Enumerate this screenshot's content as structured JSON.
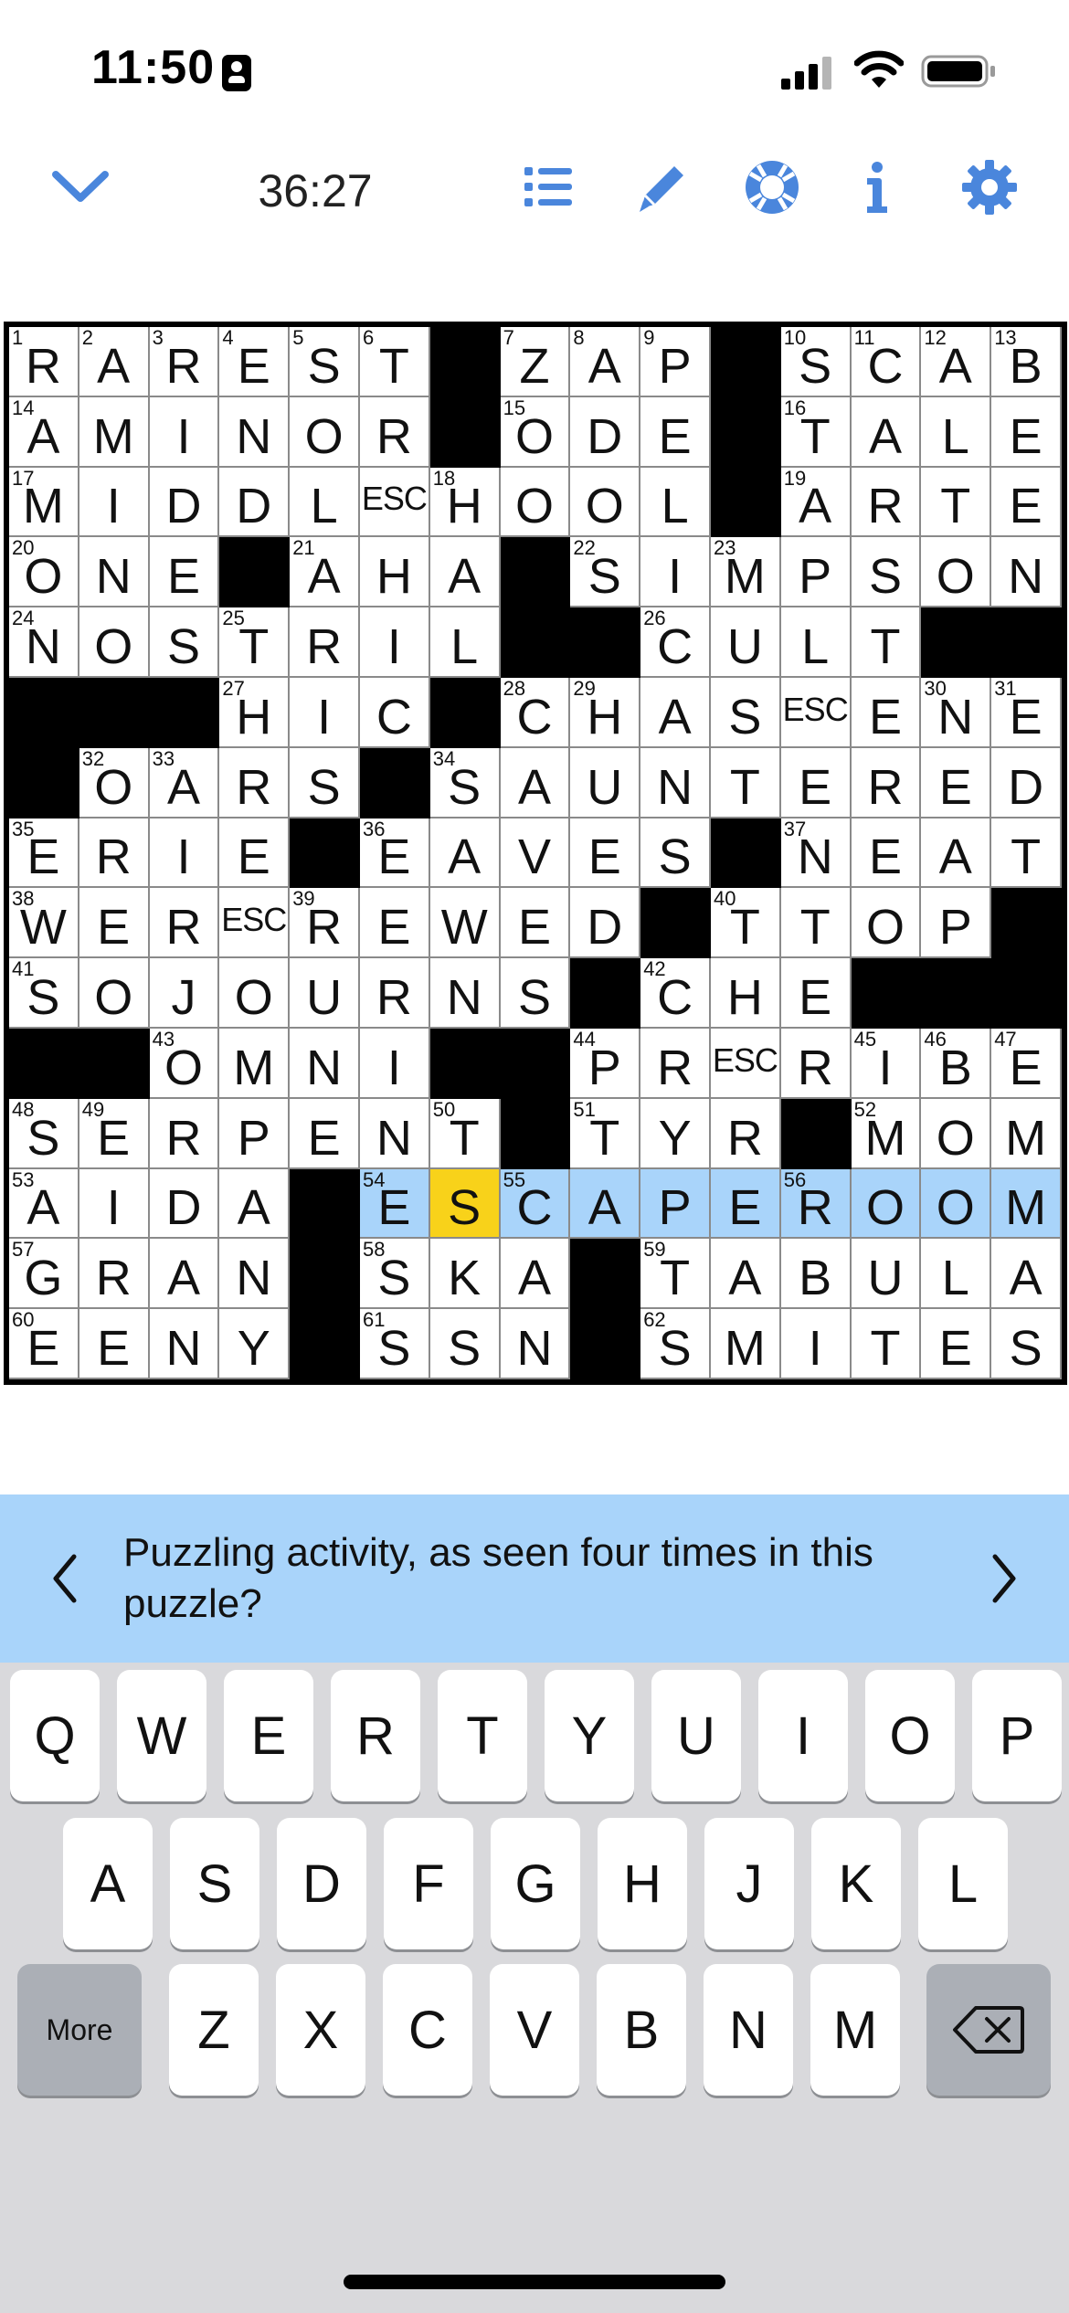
{
  "status_bar": {
    "time": "11:50",
    "icons": [
      "id-badge-icon",
      "signal-icon",
      "wifi-icon",
      "battery-icon"
    ]
  },
  "toolbar": {
    "timer": "36:27",
    "icons": [
      "chevron-down-icon",
      "list-icon",
      "pencil-icon",
      "lifebuoy-icon",
      "info-icon",
      "gear-icon"
    ],
    "accent_color": "#4a86dc"
  },
  "puzzle": {
    "grid": [
      [
        "R",
        "A",
        "R",
        "E",
        "S",
        "T",
        "#",
        "Z",
        "A",
        "P",
        "#",
        "S",
        "C",
        "A",
        "B"
      ],
      [
        "A",
        "M",
        "I",
        "N",
        "O",
        "R",
        "#",
        "O",
        "D",
        "E",
        "#",
        "T",
        "A",
        "L",
        "E"
      ],
      [
        "M",
        "I",
        "D",
        "D",
        "L",
        "ESC",
        "H",
        "O",
        "O",
        "L",
        "#",
        "A",
        "R",
        "T",
        "E"
      ],
      [
        "O",
        "N",
        "E",
        "#",
        "A",
        "H",
        "A",
        "#",
        "S",
        "I",
        "M",
        "P",
        "S",
        "O",
        "N"
      ],
      [
        "N",
        "O",
        "S",
        "T",
        "R",
        "I",
        "L",
        "#",
        "#",
        "C",
        "U",
        "L",
        "T",
        "#",
        "#"
      ],
      [
        "#",
        "#",
        "#",
        "H",
        "I",
        "C",
        "#",
        "C",
        "H",
        "A",
        "S",
        "ESC",
        "E",
        "N",
        "E"
      ],
      [
        "#",
        "O",
        "A",
        "R",
        "S",
        "#",
        "S",
        "A",
        "U",
        "N",
        "T",
        "E",
        "R",
        "E",
        "D"
      ],
      [
        "E",
        "R",
        "I",
        "E",
        "#",
        "E",
        "A",
        "V",
        "E",
        "S",
        "#",
        "N",
        "E",
        "A",
        "T"
      ],
      [
        "W",
        "E",
        "R",
        "ESC",
        "R",
        "E",
        "W",
        "E",
        "D",
        "#",
        "T",
        "T",
        "O",
        "P",
        "#"
      ],
      [
        "S",
        "O",
        "J",
        "O",
        "U",
        "R",
        "N",
        "S",
        "#",
        "C",
        "H",
        "E",
        "#",
        "#",
        "#"
      ],
      [
        "#",
        "#",
        "O",
        "M",
        "N",
        "I",
        "#",
        "#",
        "P",
        "R",
        "ESC",
        "R",
        "I",
        "B",
        "E"
      ],
      [
        "S",
        "E",
        "R",
        "P",
        "E",
        "N",
        "T",
        "#",
        "T",
        "Y",
        "R",
        "#",
        "M",
        "O",
        "M"
      ],
      [
        "A",
        "I",
        "D",
        "A",
        "#",
        "E",
        "S",
        "C",
        "A",
        "P",
        "E",
        "R",
        "O",
        "O",
        "M"
      ],
      [
        "G",
        "R",
        "A",
        "N",
        "#",
        "S",
        "K",
        "A",
        "#",
        "T",
        "A",
        "B",
        "U",
        "L",
        "A"
      ],
      [
        "E",
        "E",
        "N",
        "Y",
        "#",
        "S",
        "S",
        "N",
        "#",
        "S",
        "M",
        "I",
        "T",
        "E",
        "S"
      ]
    ],
    "numbers": [
      [
        1,
        2,
        3,
        4,
        5,
        6,
        0,
        7,
        8,
        9,
        0,
        10,
        11,
        12,
        13
      ],
      [
        14,
        0,
        0,
        0,
        0,
        0,
        0,
        15,
        0,
        0,
        0,
        16,
        0,
        0,
        0
      ],
      [
        17,
        0,
        0,
        0,
        0,
        0,
        18,
        0,
        0,
        0,
        0,
        19,
        0,
        0,
        0
      ],
      [
        20,
        0,
        0,
        0,
        21,
        0,
        0,
        0,
        22,
        0,
        23,
        0,
        0,
        0,
        0
      ],
      [
        24,
        0,
        0,
        25,
        0,
        0,
        0,
        0,
        0,
        26,
        0,
        0,
        0,
        0,
        0
      ],
      [
        0,
        0,
        0,
        27,
        0,
        0,
        0,
        28,
        29,
        0,
        0,
        0,
        0,
        30,
        31
      ],
      [
        0,
        32,
        33,
        0,
        0,
        0,
        34,
        0,
        0,
        0,
        0,
        0,
        0,
        0,
        0
      ],
      [
        35,
        0,
        0,
        0,
        0,
        36,
        0,
        0,
        0,
        0,
        0,
        37,
        0,
        0,
        0
      ],
      [
        38,
        0,
        0,
        0,
        39,
        0,
        0,
        0,
        0,
        0,
        40,
        0,
        0,
        0,
        0
      ],
      [
        41,
        0,
        0,
        0,
        0,
        0,
        0,
        0,
        0,
        42,
        0,
        0,
        0,
        0,
        0
      ],
      [
        0,
        0,
        43,
        0,
        0,
        0,
        0,
        0,
        44,
        0,
        0,
        0,
        45,
        46,
        47
      ],
      [
        48,
        49,
        0,
        0,
        0,
        0,
        50,
        0,
        51,
        0,
        0,
        0,
        52,
        0,
        0
      ],
      [
        53,
        0,
        0,
        0,
        0,
        54,
        0,
        55,
        0,
        0,
        0,
        56,
        0,
        0,
        0
      ],
      [
        57,
        0,
        0,
        0,
        0,
        58,
        0,
        0,
        0,
        59,
        0,
        0,
        0,
        0,
        0
      ],
      [
        60,
        0,
        0,
        0,
        0,
        61,
        0,
        0,
        0,
        62,
        0,
        0,
        0,
        0,
        0
      ]
    ],
    "highlighted_row": 12,
    "highlighted_cols": [
      5,
      6,
      7,
      8,
      9,
      10,
      11,
      12,
      13,
      14
    ],
    "cursor": {
      "row": 12,
      "col": 6
    },
    "colors": {
      "highlight": "#a9d4fa",
      "cursor": "#f8d21a"
    }
  },
  "clue": {
    "text": "Puzzling activity, as seen four times in this puzzle?",
    "prev_icon": "chevron-left-icon",
    "next_icon": "chevron-right-icon"
  },
  "keyboard": {
    "row1": [
      "Q",
      "W",
      "E",
      "R",
      "T",
      "Y",
      "U",
      "I",
      "O",
      "P"
    ],
    "row2": [
      "A",
      "S",
      "D",
      "F",
      "G",
      "H",
      "J",
      "K",
      "L"
    ],
    "row3": [
      "Z",
      "X",
      "C",
      "V",
      "B",
      "N",
      "M"
    ],
    "more_label": "More",
    "backspace_icon": "backspace-icon"
  }
}
